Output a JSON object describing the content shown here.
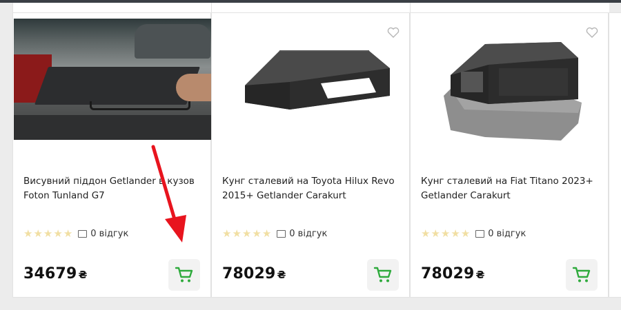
{
  "colors": {
    "cart_icon": "#2eaa3c",
    "star": "#f1dfa3",
    "arrow": "#e8141e",
    "heart": "#b5b5b5"
  },
  "products": [
    {
      "title": "Висувний піддон Getlander в кузов Foton Tunland G7",
      "rating_stars": 5,
      "reviews": "0 відгук",
      "price": "34679",
      "currency": "₴",
      "image": "tray-photo"
    },
    {
      "title": "Кунг сталевий на Toyota Hilux Revo 2015+ Getlander Carakurt",
      "rating_stars": 5,
      "reviews": "0 відгук",
      "price": "78029",
      "currency": "₴",
      "image": "canopy-render"
    },
    {
      "title": "Кунг сталевий на Fiat Titano 2023+ Getlander Carakurt",
      "rating_stars": 5,
      "reviews": "0 відгук",
      "price": "78029",
      "currency": "₴",
      "image": "canopy-on-bed-render"
    }
  ],
  "icons": {
    "favorite": "heart-icon",
    "cart": "cart-icon",
    "reviews": "comment-icon",
    "annotation": "red-arrow"
  }
}
